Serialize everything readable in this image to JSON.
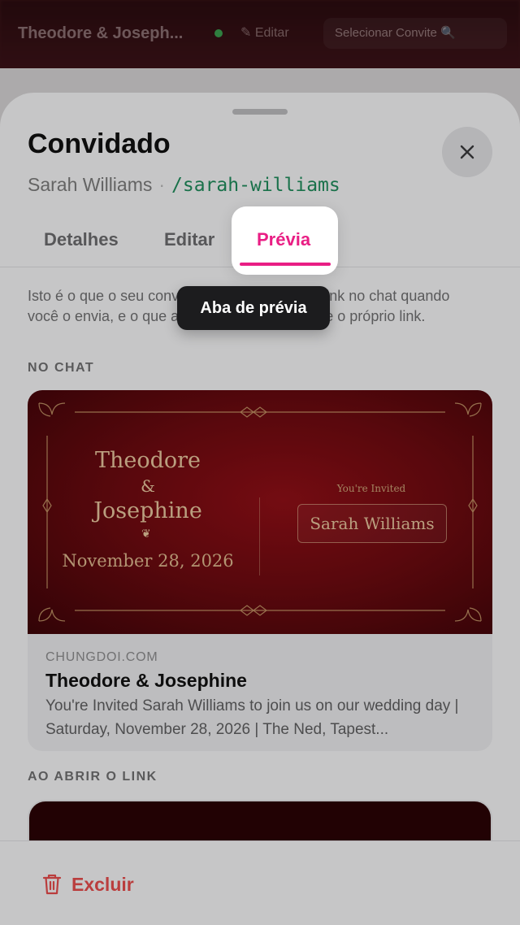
{
  "background_app": {
    "title": "Theodore & Joseph...",
    "edit_label": "✎ Editar",
    "select_label": "Selecionar Convite 🔍"
  },
  "sheet": {
    "title": "Convidado",
    "guest_name": "Sarah Williams",
    "separator": "·",
    "slug": "/sarah-williams",
    "close_icon": "close-icon",
    "tabs": [
      {
        "label": "Detalhes",
        "active": false
      },
      {
        "label": "Editar",
        "active": false
      },
      {
        "label": "Prévia",
        "active": true
      }
    ],
    "helper_text": "Isto é o que o seu convidado vê na prévia do link no chat quando você o envia, e o que aparece quando ele abre o próprio link.",
    "section_chat": "NO CHAT",
    "section_open": "AO ABRIR O LINK"
  },
  "preview_card": {
    "name_1": "Theodore",
    "ampersand": "&",
    "name_2": "Josephine",
    "heart": "❦",
    "date": "November 28, 2026",
    "invited_label": "You're Invited",
    "guest_name": "Sarah Williams",
    "domain": "CHUNGDOI.COM",
    "title": "Theodore & Josephine",
    "description": "You're Invited Sarah Williams to join us on our wedding day | Saturday, November 28, 2026 | The Ned, Tapest..."
  },
  "footer": {
    "delete_label": "Excluir",
    "delete_icon": "trash-icon"
  },
  "tooltip": {
    "text": "Aba de prévia"
  },
  "colors": {
    "accent": "#e91e84",
    "slug": "#1f8a5b",
    "danger": "#e34b4b",
    "card_red": "#7a0a10",
    "gold": "#e3c39b"
  }
}
